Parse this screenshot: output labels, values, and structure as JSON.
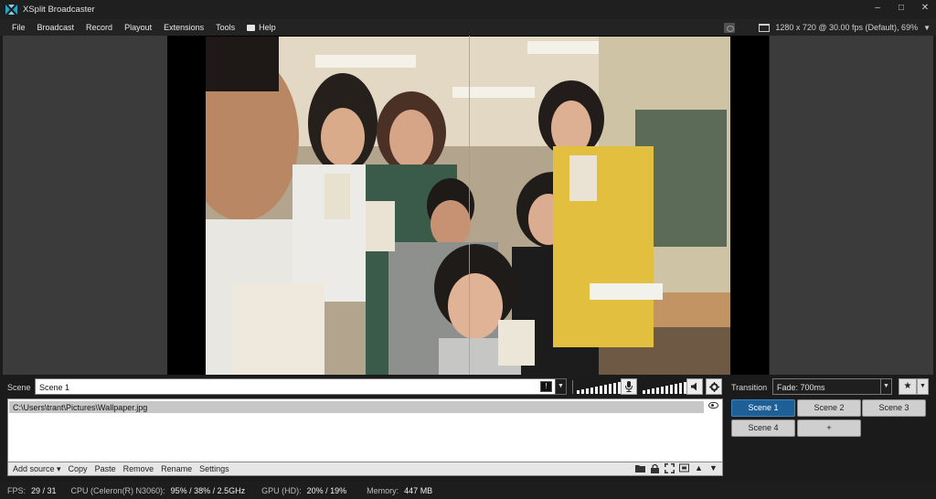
{
  "window": {
    "title": "XSplit Broadcaster",
    "controls": {
      "minimize": "–",
      "maximize": "□",
      "close": "✕"
    }
  },
  "menu": {
    "items": [
      "File",
      "Broadcast",
      "Record",
      "Playout",
      "Extensions",
      "Tools",
      "Help"
    ],
    "resolution": "1280 x 720 @ 30.00 fps (Default), 69%"
  },
  "scene": {
    "label": "Scene",
    "name": "Scene 1",
    "stats_glyph": "!"
  },
  "audio": {
    "mic_icon": "microphone-icon",
    "speaker_icon": "speaker-icon",
    "settings_icon": "gear-icon"
  },
  "transition": {
    "label": "Transition",
    "value": "Fade: 700ms"
  },
  "sources": {
    "items": [
      "C:\\Users\\trant\\Pictures\\Wallpaper.jpg"
    ],
    "toolbar": [
      "Add source ▾",
      "Copy",
      "Paste",
      "Remove",
      "Rename",
      "Settings"
    ]
  },
  "scenes": [
    "Scene 1",
    "Scene 2",
    "Scene 3",
    "Scene 4",
    "+"
  ],
  "status": {
    "fps_label": "FPS:",
    "fps_value": "29 / 31",
    "cpu_label": "CPU (Celeron(R) N3060):",
    "cpu_value": "95% / 38% / 2.5GHz",
    "gpu_label": "GPU (HD):",
    "gpu_value": "20% / 19%",
    "memory_label": "Memory:",
    "memory_value": "447 MB"
  },
  "colors": {
    "accent": "#1e5f95",
    "panel": "#3b3b3b",
    "preview_guide": "#d47ad8"
  }
}
